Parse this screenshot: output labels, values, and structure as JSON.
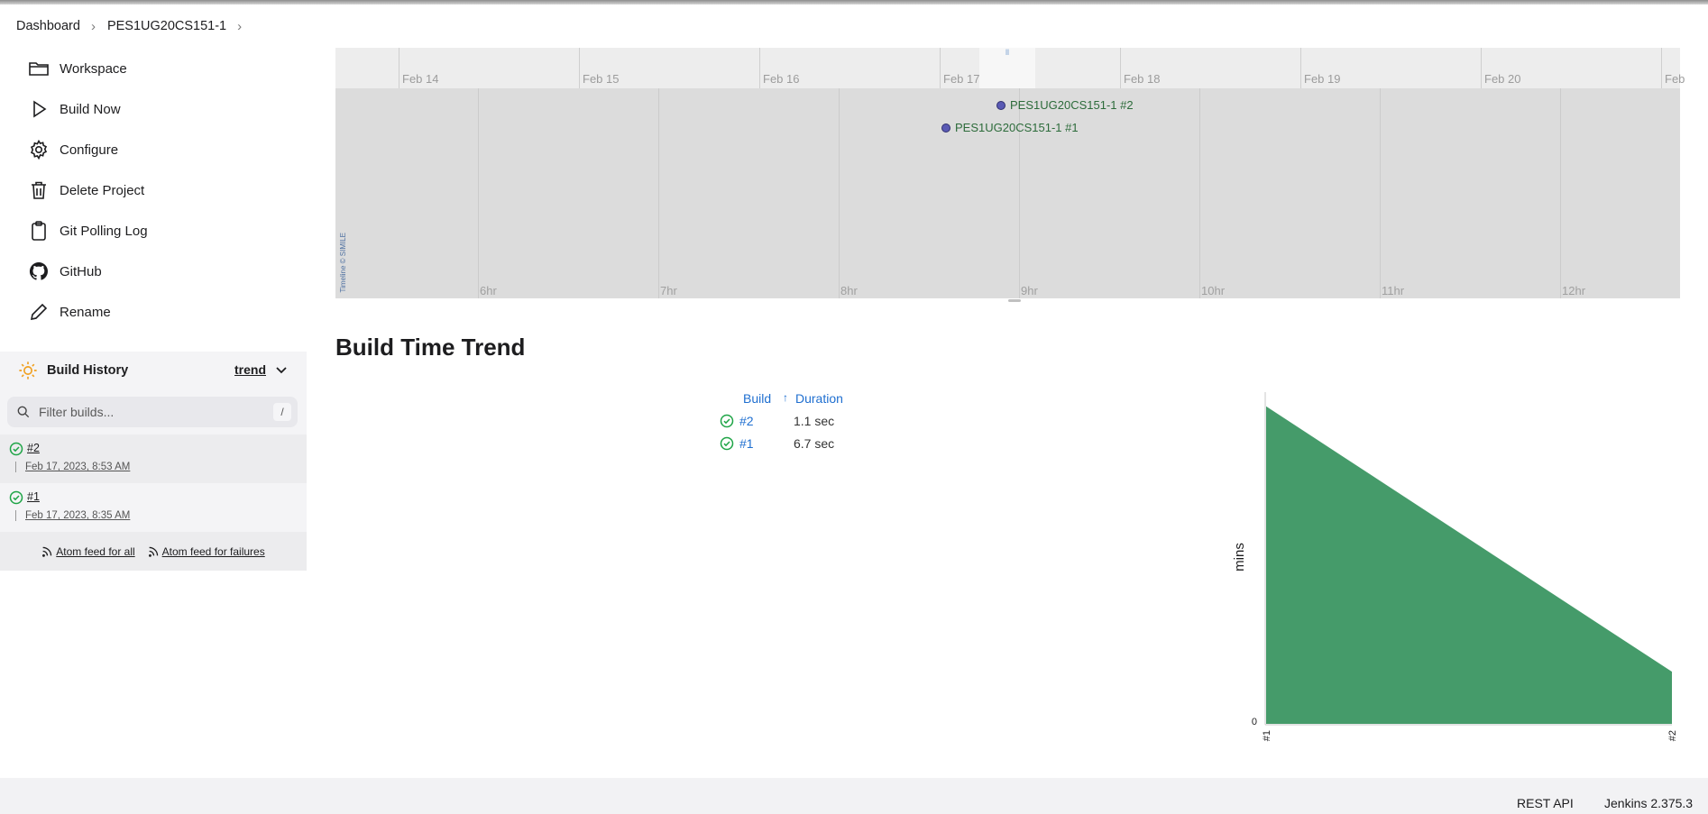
{
  "breadcrumb": {
    "items": [
      "Dashboard",
      "PES1UG20CS151-1"
    ]
  },
  "sidebar": {
    "tasks": [
      {
        "label": "Workspace",
        "icon": "folder-icon"
      },
      {
        "label": "Build Now",
        "icon": "play-icon"
      },
      {
        "label": "Configure",
        "icon": "gear-icon"
      },
      {
        "label": "Delete Project",
        "icon": "trash-icon"
      },
      {
        "label": "Git Polling Log",
        "icon": "clipboard-icon"
      },
      {
        "label": "GitHub",
        "icon": "github-icon"
      },
      {
        "label": "Rename",
        "icon": "pencil-icon"
      }
    ]
  },
  "build_history": {
    "title": "Build History",
    "trend_label": "trend",
    "filter_placeholder": "Filter builds...",
    "filter_shortcut": "/",
    "builds": [
      {
        "number": "#2",
        "date": "Feb 17, 2023, 8:53 AM",
        "status": "success"
      },
      {
        "number": "#1",
        "date": "Feb 17, 2023, 8:35 AM",
        "status": "success"
      }
    ],
    "feeds": {
      "all": "Atom feed for all",
      "failures": "Atom feed for failures"
    }
  },
  "timeline": {
    "day_labels": [
      "Feb 14",
      "Feb 15",
      "Feb 16",
      "Feb 17",
      "Feb 18",
      "Feb 19",
      "Feb 20",
      "Feb"
    ],
    "hour_labels": [
      "6hr",
      "7hr",
      "8hr",
      "9hr",
      "10hr",
      "11hr",
      "12hr"
    ],
    "events": [
      {
        "label": "PES1UG20CS151-1 #2"
      },
      {
        "label": "PES1UG20CS151-1 #1"
      }
    ],
    "copyright": "Timeline © SIMILE",
    "highlight_mark": "ll"
  },
  "build_time_trend": {
    "title": "Build Time Trend",
    "col_build": "Build",
    "sort_arrow": "↑",
    "col_duration": "Duration",
    "rows": [
      {
        "build": "#2",
        "duration": "1.1 sec",
        "status": "success"
      },
      {
        "build": "#1",
        "duration": "6.7 sec",
        "status": "success"
      }
    ]
  },
  "chart_data": {
    "type": "area",
    "categories": [
      "#1",
      "#2"
    ],
    "series": [
      {
        "values": [
          6.7,
          1.1
        ],
        "color": "#459b6a"
      }
    ],
    "ylabel": "mins",
    "y_tick_labels": [
      "0"
    ],
    "ylim": [
      0,
      7.0
    ],
    "grid": false
  },
  "footer": {
    "rest_api": "REST API",
    "version": "Jenkins 2.375.3"
  },
  "colors": {
    "success": "#1ea446",
    "link": "#1f6fd0",
    "chart_fill": "#459b6a"
  }
}
